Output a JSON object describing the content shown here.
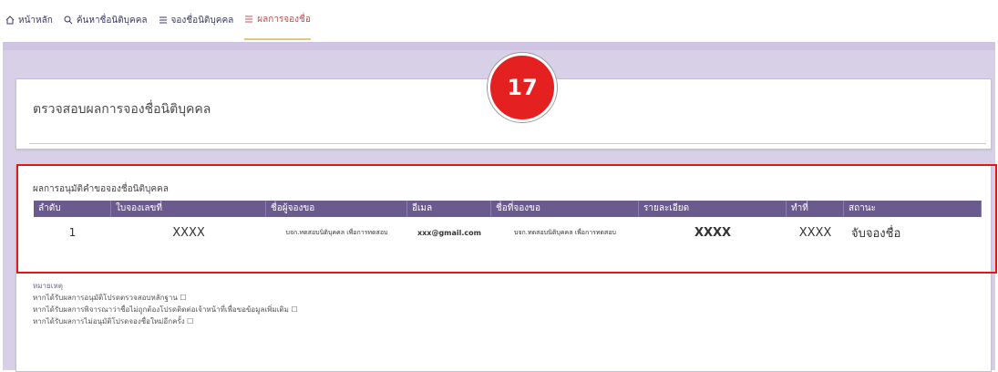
{
  "nav": {
    "items": [
      {
        "label": "หน้าหลัก",
        "icon": "home-icon"
      },
      {
        "label": "ค้นหาชื่อนิติบุคคล",
        "icon": "search-icon"
      },
      {
        "label": "จองชื่อนิติบุคคล",
        "icon": "list-icon"
      },
      {
        "label": "ผลการจองชื่อ",
        "icon": "list-icon"
      }
    ],
    "active_index": 3
  },
  "page": {
    "title": "ตรวจสอบผลการจองชื่อนิติบุคคล",
    "result_section_title": "ผลการอนุมัติคำขอจองชื่อนิติบุคคล"
  },
  "table": {
    "headers": [
      "ลำดับ",
      "ใบจองเลขที่",
      "ชื่อผู้จองขอ",
      "อีเมล",
      "ชื่อที่จองขอ",
      "รายละเอียด",
      "ทำที่",
      "สถานะ"
    ],
    "rows": [
      [
        "1",
        "XXXX",
        "บจก.ทดสอบนิติบุคคล เพื่อการทดสอบ",
        "xxx@gmail.com",
        "บจก.ทดสอบนิติบุคคล เพื่อการทดสอบ",
        "XXXX",
        "XXXX",
        "จับจองชื่อ"
      ]
    ]
  },
  "notes": {
    "heading": "หมายเหตุ",
    "lines": [
      "หากได้รับผลการอนุมัติโปรดตรวจสอบหลักฐาน ☐",
      "หากได้รับผลการพิจารณาว่าชื่อไม่ถูกต้องโปรดติดต่อเจ้าหน้าที่เพื่อขอข้อมูลเพิ่มเติม ☐",
      "หากได้รับผลการไม่อนุมัติโปรดจองชื่อใหม่อีกครั้ง ☐"
    ]
  },
  "annotation": {
    "step_number": "17",
    "badge_color": "#e52020",
    "highlight_color": "#e01818"
  },
  "colors": {
    "table_header": "#6a5a8e",
    "frame": "#d7d0e6"
  }
}
